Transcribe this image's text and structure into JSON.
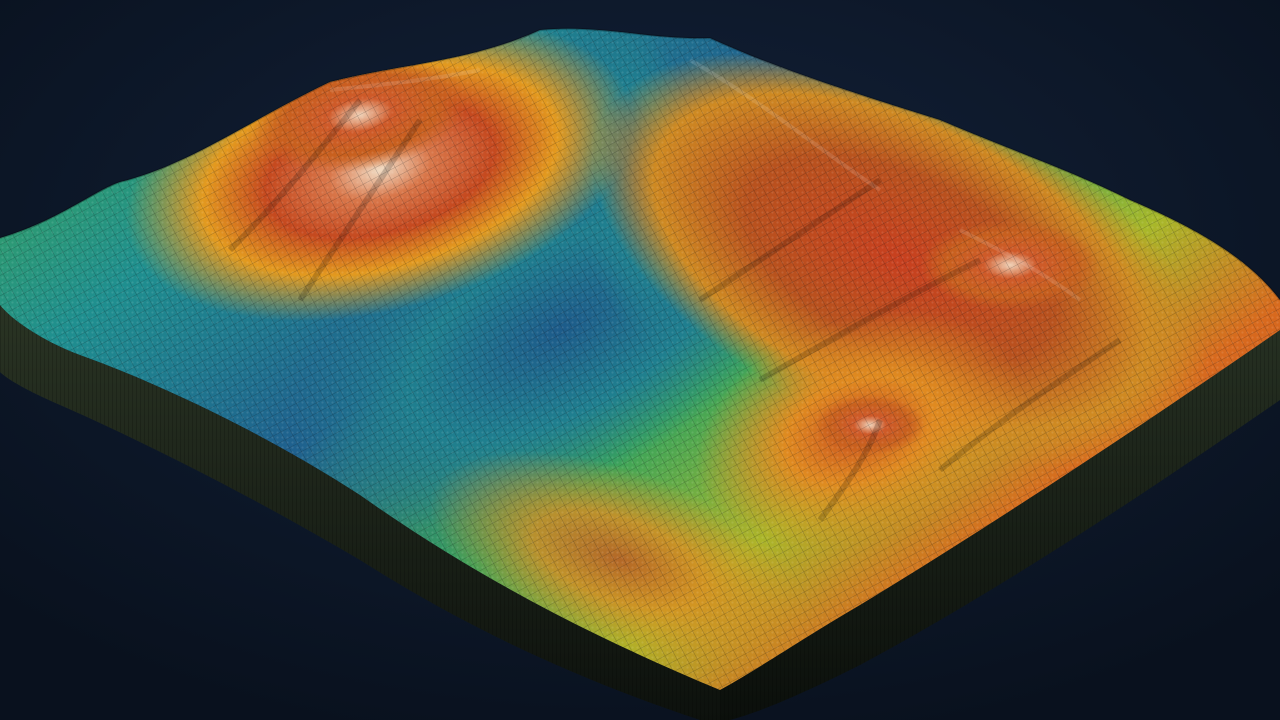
{
  "scene": {
    "subject": "terrain-relief-model",
    "colors": {
      "background": "#0c1626",
      "base_side": "#1a2018",
      "base_side_dark": "#0e120e",
      "elevation_ramp": [
        "#1f5f8e",
        "#1f8f8f",
        "#3aa45a",
        "#a8b82a",
        "#e0a020",
        "#d86a1e",
        "#b83a20",
        "#e8cdb0"
      ]
    }
  }
}
